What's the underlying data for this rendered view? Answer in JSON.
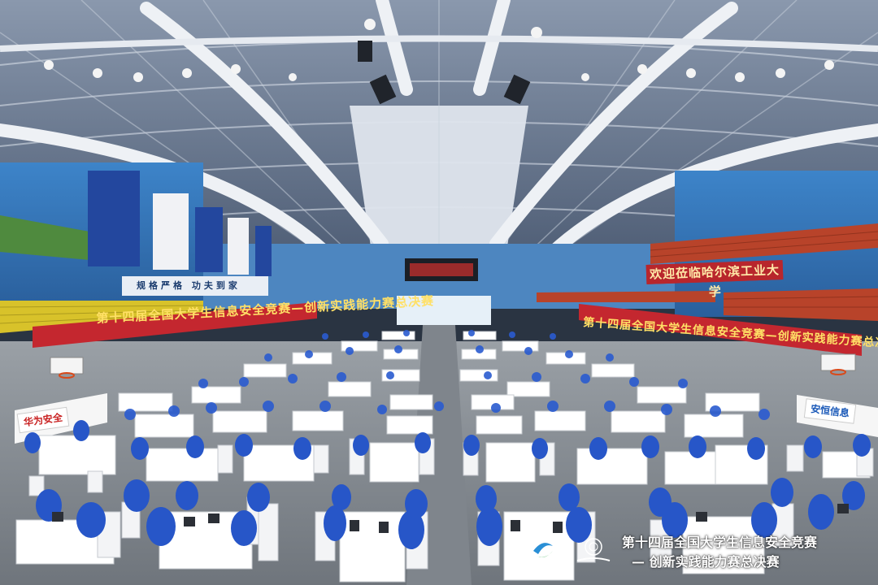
{
  "scene": {
    "type": "photograph",
    "subject": "indoor arena hosting a student information-security competition final"
  },
  "banners": {
    "left": "第十四届全国大学生信息安全竞赛—创新实践能力赛总决赛",
    "right": "第十四届全国大学生信息安全竞赛—创新实践能力赛总决赛"
  },
  "signs": {
    "university": "欢迎莅临哈尔滨工业大学",
    "slogan": "规格严格 功夫到家"
  },
  "sponsors": {
    "left": "华为安全",
    "right": "安恒信息"
  },
  "caption": {
    "line1": "第十四届全国大学生信息安全竞赛",
    "line2": "— 创新实践能力赛总决赛"
  },
  "colors": {
    "roof": "#5b6b84",
    "banner_red": "#c4272f",
    "banner_text": "#ffe066",
    "seats_left": "#d8c22a",
    "seats_right": "#b8432a",
    "floor": "#8b9097",
    "table_cloth": "#ffffff",
    "shirt_blue": "#2756c8",
    "wall_blue": "#2f6fb5"
  }
}
